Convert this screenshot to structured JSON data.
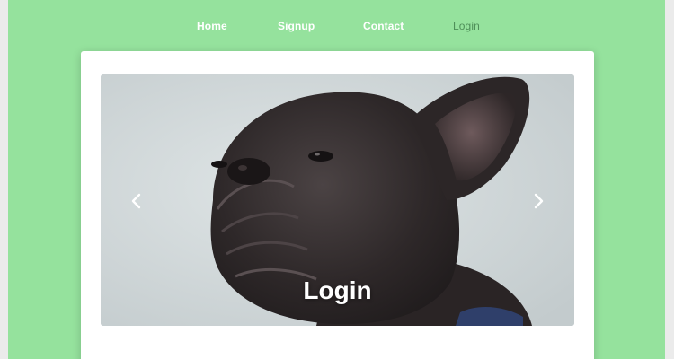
{
  "nav": {
    "items": [
      {
        "label": "Home"
      },
      {
        "label": "Signup"
      },
      {
        "label": "Contact"
      },
      {
        "label": "Login",
        "active": true
      }
    ]
  },
  "carousel": {
    "caption": "Login",
    "image": "french-bulldog-photo",
    "prev_icon": "chevron-left-icon",
    "next_icon": "chevron-right-icon"
  },
  "colors": {
    "background": "#95e29d",
    "card": "#ffffff",
    "active_nav": "#4f8f59"
  }
}
